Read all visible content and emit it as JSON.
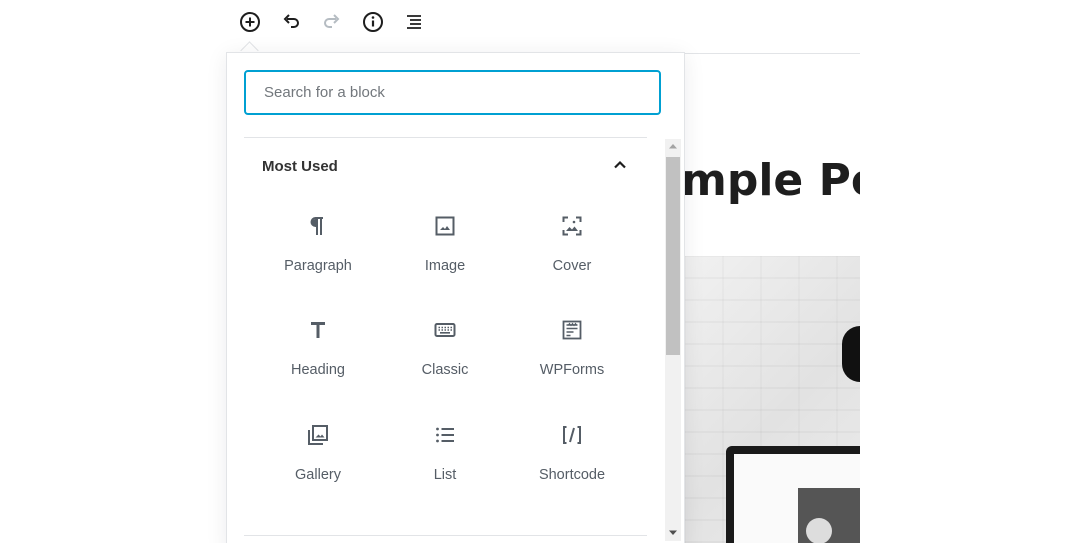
{
  "toolbar": {
    "buttons": [
      {
        "name": "add-block",
        "icon": "plus-circle-icon"
      },
      {
        "name": "undo",
        "icon": "undo-icon"
      },
      {
        "name": "redo",
        "icon": "redo-icon"
      },
      {
        "name": "info",
        "icon": "info-icon"
      },
      {
        "name": "block-navigation",
        "icon": "list-outline-icon"
      }
    ]
  },
  "editor": {
    "title_fragment": "mple Po"
  },
  "inserter": {
    "search": {
      "value": "",
      "placeholder": "Search for a block"
    },
    "panel": {
      "title": "Most Used",
      "expanded": true,
      "blocks": [
        {
          "label": "Paragraph",
          "icon": "paragraph-icon"
        },
        {
          "label": "Image",
          "icon": "image-icon"
        },
        {
          "label": "Cover",
          "icon": "cover-icon"
        },
        {
          "label": "Heading",
          "icon": "heading-icon"
        },
        {
          "label": "Classic",
          "icon": "keyboard-icon"
        },
        {
          "label": "WPForms",
          "icon": "wpforms-icon"
        },
        {
          "label": "Gallery",
          "icon": "gallery-icon"
        },
        {
          "label": "List",
          "icon": "list-icon"
        },
        {
          "label": "Shortcode",
          "icon": "shortcode-icon"
        }
      ]
    }
  },
  "colors": {
    "accent": "#00a0d2",
    "icon": "#555d66",
    "text": "#1e1e1e",
    "border": "#e2e4e7"
  }
}
